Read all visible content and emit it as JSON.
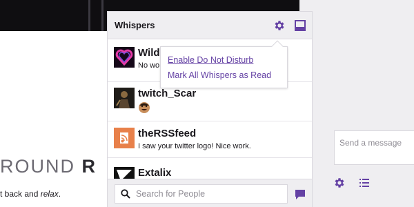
{
  "background_page": {
    "heading_light": "ROUND ",
    "heading_bold": "R",
    "text_line1_plain": "t back and ",
    "text_line1_italic": "relax",
    "text_line1_end": "."
  },
  "whispers": {
    "title": "Whispers",
    "threads": [
      {
        "name": "Wildl",
        "message": "No wo"
      },
      {
        "name": "twitch_Scar",
        "message": ""
      },
      {
        "name": "theRSSfeed",
        "message": "I saw your twitter logo! Nice work."
      },
      {
        "name": "Extalix",
        "message": ""
      }
    ],
    "search_placeholder": "Search for People"
  },
  "dropdown": {
    "items": [
      "Enable Do Not Disturb",
      "Mark All Whispers as Read"
    ]
  },
  "chat": {
    "input_placeholder": "Send a message"
  },
  "colors": {
    "accent": "#6441a4",
    "header_bg": "#efeef1",
    "border": "#dad8de"
  }
}
